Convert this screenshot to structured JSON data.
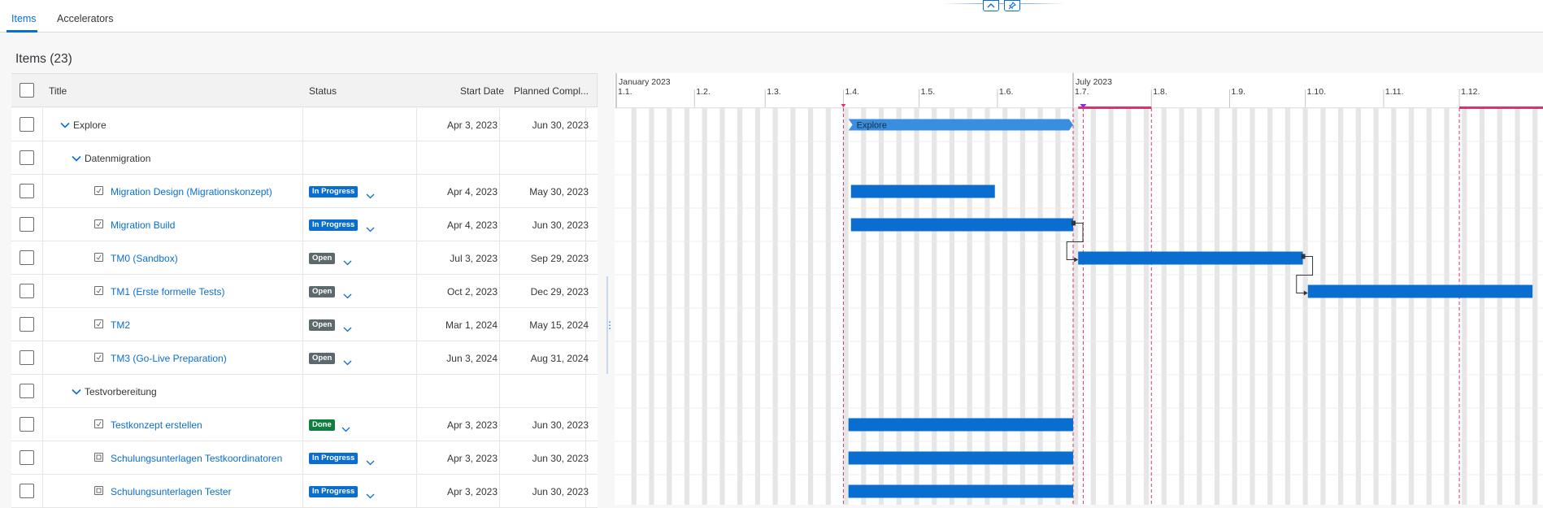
{
  "tabs": [
    {
      "label": "Items",
      "active": true
    },
    {
      "label": "Accelerators",
      "active": false
    }
  ],
  "header_buttons": {
    "collapse_icon": "chevron-up-icon",
    "pin_icon": "pin-icon"
  },
  "items_heading": "Items (23)",
  "table": {
    "columns": [
      "Title",
      "Status",
      "Start Date",
      "Planned Compl..."
    ],
    "rows": [
      {
        "title": "Explore",
        "level": 0,
        "kind": "group",
        "status": "",
        "start": "Apr 3, 2023",
        "end": "Jun 30, 2023"
      },
      {
        "title": "Datenmigration",
        "level": 1,
        "kind": "group",
        "status": "",
        "start": "",
        "end": ""
      },
      {
        "title": "Migration Design (Migrationskonzept)",
        "level": 2,
        "kind": "task",
        "status": "In Progress",
        "start": "Apr 4, 2023",
        "end": "May 30, 2023"
      },
      {
        "title": "Migration Build",
        "level": 2,
        "kind": "task",
        "status": "In Progress",
        "start": "Apr 4, 2023",
        "end": "Jun 30, 2023"
      },
      {
        "title": "TM0 (Sandbox)",
        "level": 2,
        "kind": "task",
        "status": "Open",
        "start": "Jul 3, 2023",
        "end": "Sep 29, 2023"
      },
      {
        "title": "TM1 (Erste formelle Tests)",
        "level": 2,
        "kind": "task",
        "status": "Open",
        "start": "Oct 2, 2023",
        "end": "Dec 29, 2023"
      },
      {
        "title": "TM2",
        "level": 2,
        "kind": "task",
        "status": "Open",
        "start": "Mar 1, 2024",
        "end": "May 15, 2024"
      },
      {
        "title": "TM3 (Go-Live Preparation)",
        "level": 2,
        "kind": "task",
        "status": "Open",
        "start": "Jun 3, 2024",
        "end": "Aug 31, 2024"
      },
      {
        "title": "Testvorbereitung",
        "level": 1,
        "kind": "group",
        "status": "",
        "start": "",
        "end": ""
      },
      {
        "title": "Testkonzept erstellen",
        "level": 2,
        "kind": "task",
        "status": "Done",
        "start": "Apr 3, 2023",
        "end": "Jun 30, 2023"
      },
      {
        "title": "Schulungsunterlagen Testkoordinatoren",
        "level": 2,
        "kind": "doc",
        "status": "In Progress",
        "start": "Apr 3, 2023",
        "end": "Jun 30, 2023"
      },
      {
        "title": "Schulungsunterlagen Tester",
        "level": 2,
        "kind": "doc",
        "status": "In Progress",
        "start": "Apr 3, 2023",
        "end": "Jun 30, 2023"
      }
    ]
  },
  "gantt": {
    "year_labels": [
      "January 2023",
      "July 2023"
    ],
    "month_labels": [
      "1.1.",
      "1.2.",
      "1.3.",
      "1.4.",
      "1.5.",
      "1.6.",
      "1.7.",
      "1.8.",
      "1.9.",
      "1.10.",
      "1.11.",
      "1.12."
    ],
    "bars": [
      {
        "row": 0,
        "label": "Explore",
        "start": "2023-04-03",
        "end": "2023-06-30",
        "summary": true
      },
      {
        "row": 2,
        "start": "2023-04-04",
        "end": "2023-05-30"
      },
      {
        "row": 3,
        "start": "2023-04-04",
        "end": "2023-06-30"
      },
      {
        "row": 4,
        "start": "2023-07-03",
        "end": "2023-09-29"
      },
      {
        "row": 5,
        "start": "2023-10-02",
        "end": "2023-12-29"
      },
      {
        "row": 9,
        "start": "2023-04-03",
        "end": "2023-06-30"
      },
      {
        "row": 10,
        "start": "2023-04-03",
        "end": "2023-06-30"
      },
      {
        "row": 11,
        "start": "2023-04-03",
        "end": "2023-06-30"
      }
    ],
    "colors": {
      "bar": "#0a6ed1",
      "summary": "#3a8ee0",
      "marker": "#e0306a",
      "weekend": "#e6e6e6"
    }
  }
}
